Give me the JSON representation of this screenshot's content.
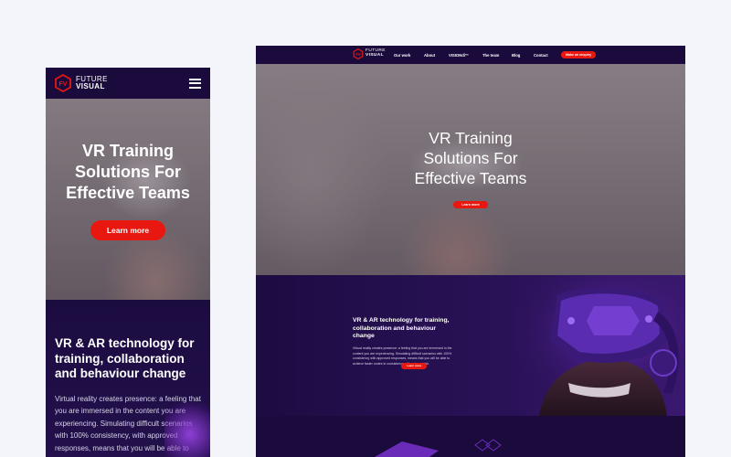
{
  "brand": {
    "line1": "FUTURE",
    "line2": "VISUAL",
    "mark": "FV"
  },
  "colors": {
    "accent": "#e8170f",
    "navy": "#1a0b3c",
    "purple": "#2a1258",
    "violet": "#8d3fd6"
  },
  "mobile": {
    "menu_icon": "hamburger-icon",
    "hero": {
      "title": "VR Training Solutions For Effective Teams",
      "cta": "Learn more"
    },
    "section": {
      "title": "VR & AR technology for training, collaboration and behaviour change",
      "body": "Virtual reality creates presence: a feeling that you are immersed in the content you are experiencing. Simulating difficult scenarios with 100% consistency, with approved responses, means that you will be able to"
    }
  },
  "desktop": {
    "nav": [
      "Our work",
      "About",
      "VISIONdi™",
      "The team",
      "Blog",
      "Contact"
    ],
    "nav_cta": "Make an enquiry",
    "hero": {
      "title": "VR Training Solutions For Effective Teams",
      "cta": "Learn more"
    },
    "section": {
      "title": "VR & AR technology for training, collaboration and behaviour change",
      "body": "Virtual reality creates presence: a feeling that you are immersed in the content you are experiencing. Simulating difficult scenarios with 100% consistency with approved responses, means that you will be able to achieve faster routes to consistency with reduced risk.",
      "cta": "Learn more"
    }
  }
}
